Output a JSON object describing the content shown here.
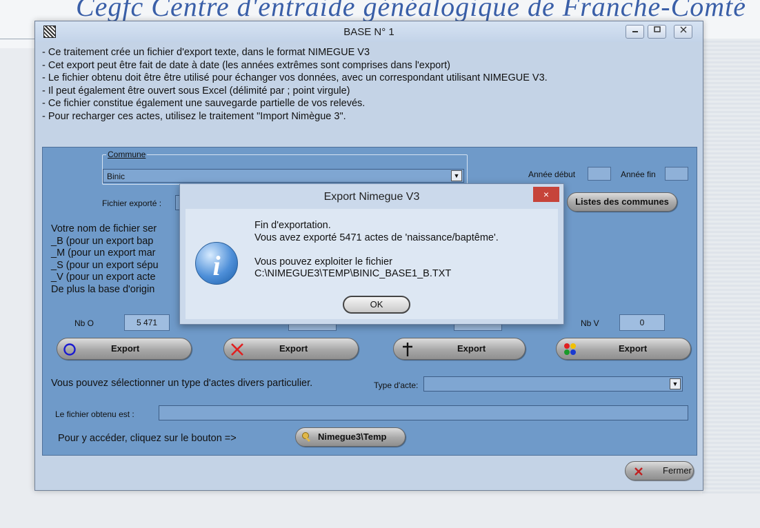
{
  "background": {
    "title": "Cegfc  Centre d'entraide généalogique de Franche-Comté"
  },
  "window": {
    "title": "BASE N° 1",
    "description": [
      "- Ce traitement crée un fichier d'export texte, dans le format NIMEGUE V3",
      "- Cet export peut être fait de date à date (les années extrêmes sont comprises dans l'export)",
      "- Le fichier obtenu doit être être utilisé pour échanger vos données, avec un correspondant utilisant NIMEGUE V3.",
      "- Il peut également être ouvert sous Excel (délimité par ;  point virgule)",
      "- Ce fichier constitue également une sauvegarde partielle de vos relevés.",
      "- Pour recharger ces actes, utilisez le traitement \"Import Nimègue 3\"."
    ],
    "commune_label": "Commune",
    "commune_value": "Binic",
    "annee_debut_label": "Année début",
    "annee_fin_label": "Année fin",
    "fichier_exporte_label": "Fichier exporté :",
    "listes_button": "Listes des communes",
    "naming_text": [
      "Votre nom de fichier ser",
      "_B (pour un export bap",
      "_M (pour un export mar",
      "_S (pour un export sépu",
      "_V (pour un export acte",
      "De plus la base d'origin"
    ],
    "nb_o_label": "Nb O",
    "nb_o_value": "5 471",
    "nb_v_label": "Nb V",
    "nb_v_value": "0",
    "export_label": "Export",
    "divers_text": "Vous pouvez sélectionner un type d'actes divers particulier.",
    "type_acte_label": "Type d'acte:",
    "fichier_obtenu_label": "Le fichier obtenu est :",
    "acceder_text": "Pour y accéder, cliquez sur le bouton =>",
    "nimegue_button": "Nimegue3\\Temp",
    "fermer_button": "Fermer"
  },
  "dialog": {
    "title": "Export Nimegue V3",
    "close_glyph": "×",
    "lines": [
      "Fin d'exportation.",
      "Vous avez exporté 5471 actes de 'naissance/baptême'.",
      "",
      "Vous pouvez exploiter le fichier",
      "C:\\NIMEGUE3\\TEMP\\BINIC_BASE1_B.TXT"
    ],
    "ok_label": "OK"
  },
  "icons": {
    "baptism": "circle-icon",
    "marriage": "cross-x-icon",
    "burial": "latin-cross-icon",
    "misc": "colored-dots-icon",
    "info": "info-icon",
    "key": "key-icon",
    "close": "close-icon"
  },
  "colors": {
    "panel": "#6f9ac9",
    "window": "#c4d3e6",
    "dialog_close": "#c6443a"
  }
}
